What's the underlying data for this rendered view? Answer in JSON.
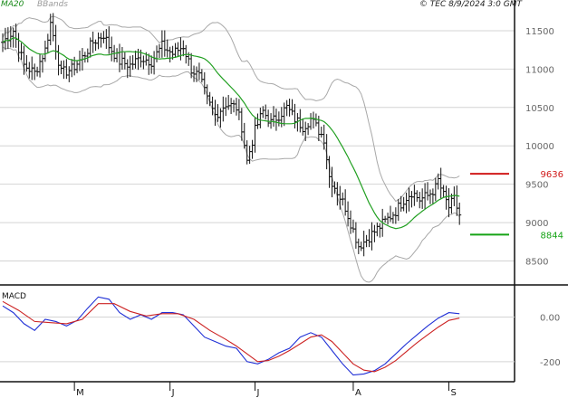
{
  "header": {
    "legend_ma": "MA20",
    "legend_bb": "BBands",
    "copyright": "© TEC 8/9/2024 3:0 GMT"
  },
  "colors": {
    "background": "#ffffff",
    "grid": "#d4d4d4",
    "price": "#111111",
    "ma20": "#22a022",
    "bbands": "#a8a8a8",
    "resistance": "#d11a1a",
    "support": "#16a316",
    "macd": "#1f2fd6",
    "signal": "#cc2222"
  },
  "chart_data": [
    {
      "type": "ohlc",
      "name": "price",
      "y_ticks": [
        {
          "value": 8500,
          "label": "8500"
        },
        {
          "value": 9000,
          "label": "9000"
        },
        {
          "value": 9500,
          "label": "9500"
        },
        {
          "value": 10000,
          "label": "10000"
        },
        {
          "value": 10500,
          "label": "10500"
        },
        {
          "value": 11000,
          "label": "11000"
        },
        {
          "value": 11500,
          "label": "11500"
        }
      ],
      "ylim": [
        8200,
        11900
      ],
      "x_labels": [
        {
          "index": 27,
          "label": "M"
        },
        {
          "index": 63,
          "label": "J"
        },
        {
          "index": 95,
          "label": "J"
        },
        {
          "index": 132,
          "label": "A"
        },
        {
          "index": 168,
          "label": "S"
        }
      ],
      "x_count": 176,
      "grid": true,
      "indicators": [
        "MA20",
        "BBands"
      ],
      "levels": [
        {
          "name": "resistance",
          "value": 9636,
          "label": "9636",
          "color": "#d11a1a"
        },
        {
          "name": "support",
          "value": 8844,
          "label": "8844",
          "color": "#16a316"
        }
      ],
      "anchors": [
        [
          0,
          11350
        ],
        [
          4,
          11500
        ],
        [
          8,
          11050
        ],
        [
          12,
          10950
        ],
        [
          16,
          11250
        ],
        [
          18,
          11600
        ],
        [
          22,
          10950
        ],
        [
          26,
          11000
        ],
        [
          30,
          11150
        ],
        [
          34,
          11350
        ],
        [
          38,
          11450
        ],
        [
          40,
          11300
        ],
        [
          44,
          11100
        ],
        [
          48,
          11050
        ],
        [
          52,
          11150
        ],
        [
          56,
          11100
        ],
        [
          60,
          11300
        ],
        [
          64,
          11200
        ],
        [
          68,
          11300
        ],
        [
          71,
          11000
        ],
        [
          74,
          10900
        ],
        [
          77,
          10600
        ],
        [
          80,
          10400
        ],
        [
          84,
          10550
        ],
        [
          88,
          10500
        ],
        [
          90,
          10250
        ],
        [
          92,
          9800
        ],
        [
          95,
          10200
        ],
        [
          98,
          10450
        ],
        [
          101,
          10300
        ],
        [
          104,
          10400
        ],
        [
          107,
          10500
        ],
        [
          110,
          10350
        ],
        [
          113,
          10250
        ],
        [
          116,
          10350
        ],
        [
          119,
          10200
        ],
        [
          121,
          10100
        ],
        [
          123,
          9600
        ],
        [
          126,
          9400
        ],
        [
          129,
          9200
        ],
        [
          132,
          8900
        ],
        [
          134,
          8700
        ],
        [
          136,
          8750
        ],
        [
          139,
          8850
        ],
        [
          142,
          8950
        ],
        [
          145,
          9050
        ],
        [
          148,
          9150
        ],
        [
          151,
          9300
        ],
        [
          154,
          9400
        ],
        [
          157,
          9300
        ],
        [
          160,
          9350
        ],
        [
          163,
          9450
        ],
        [
          164,
          9550
        ],
        [
          166,
          9350
        ],
        [
          168,
          9200
        ],
        [
          170,
          9300
        ],
        [
          172,
          9100
        ]
      ]
    },
    {
      "type": "line",
      "name": "MACD",
      "title": "MACD",
      "y_ticks": [
        {
          "value": 0,
          "label": "0.00"
        },
        {
          "value": -200,
          "label": "-200"
        }
      ],
      "ylim": [
        -290,
        140
      ],
      "x_count": 176,
      "series": [
        {
          "name": "MACD",
          "color": "#1f2fd6",
          "points": [
            [
              0,
              50
            ],
            [
              4,
              20
            ],
            [
              8,
              -30
            ],
            [
              12,
              -60
            ],
            [
              16,
              -10
            ],
            [
              20,
              -20
            ],
            [
              24,
              -40
            ],
            [
              28,
              -15
            ],
            [
              32,
              40
            ],
            [
              36,
              90
            ],
            [
              40,
              80
            ],
            [
              44,
              20
            ],
            [
              48,
              -10
            ],
            [
              52,
              10
            ],
            [
              56,
              -10
            ],
            [
              60,
              20
            ],
            [
              64,
              20
            ],
            [
              68,
              10
            ],
            [
              72,
              -40
            ],
            [
              76,
              -90
            ],
            [
              80,
              -110
            ],
            [
              84,
              -130
            ],
            [
              88,
              -140
            ],
            [
              92,
              -200
            ],
            [
              96,
              -210
            ],
            [
              100,
              -190
            ],
            [
              104,
              -160
            ],
            [
              108,
              -140
            ],
            [
              112,
              -90
            ],
            [
              116,
              -70
            ],
            [
              120,
              -90
            ],
            [
              124,
              -150
            ],
            [
              128,
              -210
            ],
            [
              132,
              -260
            ],
            [
              136,
              -255
            ],
            [
              140,
              -240
            ],
            [
              144,
              -210
            ],
            [
              148,
              -165
            ],
            [
              152,
              -120
            ],
            [
              156,
              -80
            ],
            [
              160,
              -40
            ],
            [
              164,
              -5
            ],
            [
              168,
              20
            ],
            [
              172,
              15
            ]
          ]
        },
        {
          "name": "Signal",
          "color": "#cc2222",
          "points": [
            [
              0,
              70
            ],
            [
              6,
              30
            ],
            [
              12,
              -20
            ],
            [
              18,
              -25
            ],
            [
              24,
              -30
            ],
            [
              30,
              -10
            ],
            [
              36,
              60
            ],
            [
              42,
              60
            ],
            [
              48,
              25
            ],
            [
              54,
              5
            ],
            [
              60,
              15
            ],
            [
              66,
              15
            ],
            [
              72,
              -10
            ],
            [
              78,
              -60
            ],
            [
              84,
              -100
            ],
            [
              88,
              -130
            ],
            [
              92,
              -165
            ],
            [
              96,
              -200
            ],
            [
              100,
              -195
            ],
            [
              104,
              -175
            ],
            [
              108,
              -150
            ],
            [
              112,
              -120
            ],
            [
              116,
              -90
            ],
            [
              120,
              -80
            ],
            [
              124,
              -110
            ],
            [
              128,
              -160
            ],
            [
              132,
              -210
            ],
            [
              136,
              -238
            ],
            [
              140,
              -245
            ],
            [
              144,
              -225
            ],
            [
              148,
              -195
            ],
            [
              152,
              -155
            ],
            [
              156,
              -115
            ],
            [
              160,
              -80
            ],
            [
              164,
              -45
            ],
            [
              168,
              -15
            ],
            [
              172,
              -5
            ]
          ]
        }
      ]
    }
  ]
}
